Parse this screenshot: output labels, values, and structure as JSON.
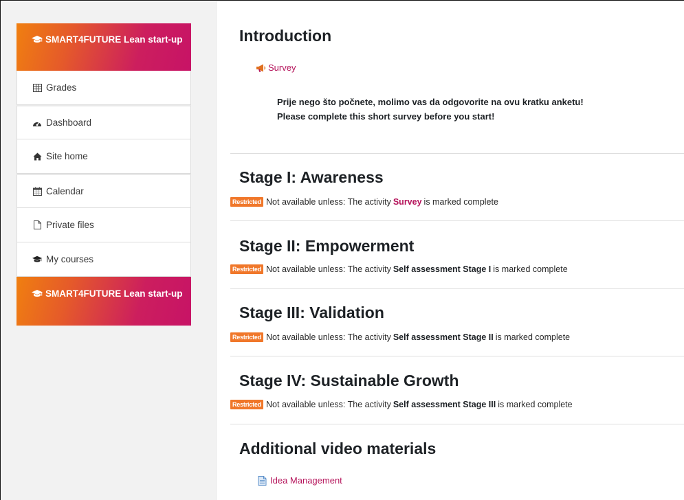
{
  "sidebar": {
    "course_header_top": "SMART4FUTURE Lean start-up",
    "items": [
      {
        "label": "Grades",
        "icon": "table-icon"
      },
      {
        "label": "Dashboard",
        "icon": "dashboard-icon"
      },
      {
        "label": "Site home",
        "icon": "home-icon"
      },
      {
        "label": "Calendar",
        "icon": "calendar-icon"
      },
      {
        "label": "Private files",
        "icon": "file-icon"
      },
      {
        "label": "My courses",
        "icon": "graduation-cap-icon"
      }
    ],
    "course_header_bottom": "SMART4FUTURE Lean start-up"
  },
  "sections": {
    "intro": {
      "title": "Introduction",
      "activity": "Survey",
      "desc_line1": "Prije nego što počnete, molimo vas da odgovorite na ovu kratku anketu!",
      "desc_line2": "Please complete this short survey before you start!"
    },
    "stage1": {
      "title": "Stage I: Awareness",
      "badge": "Restricted",
      "pre": "Not available unless: The activity",
      "activity": "Survey",
      "post": "is marked complete"
    },
    "stage2": {
      "title": "Stage II: Empowerment",
      "badge": "Restricted",
      "pre": "Not available unless: The activity",
      "activity": "Self assessment Stage I",
      "post": "is marked complete"
    },
    "stage3": {
      "title": "Stage III: Validation",
      "badge": "Restricted",
      "pre": "Not available unless: The activity",
      "activity": "Self assessment Stage II",
      "post": "is marked complete"
    },
    "stage4": {
      "title": "Stage IV: Sustainable Growth",
      "badge": "Restricted",
      "pre": "Not available unless: The activity",
      "activity": "Self assessment Stage III",
      "post": "is marked complete"
    },
    "video": {
      "title": "Additional video materials",
      "activity": "Idea Management"
    }
  },
  "colors": {
    "accent": "#b5145b",
    "gradient_start": "#f07f10",
    "gradient_end": "#c71366",
    "restricted_badge": "#f0772a"
  }
}
